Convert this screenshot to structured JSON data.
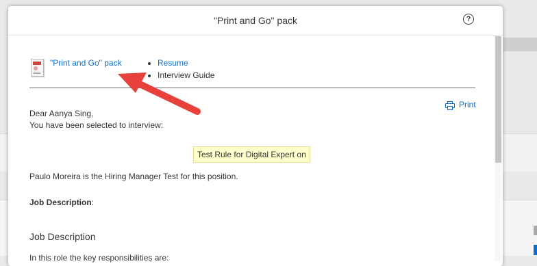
{
  "dialog": {
    "title": "\"Print and Go\" pack",
    "help_glyph": "?"
  },
  "pack": {
    "icon": "document-icon",
    "link_label": "\"Print and Go\" pack",
    "items": [
      {
        "label": "Resume",
        "is_link": true
      },
      {
        "label": "Interview Guide",
        "is_link": false
      }
    ]
  },
  "print_label": "Print",
  "letter": {
    "greeting": "Dear Aanya Sing,",
    "selected": "You have been selected to interview:",
    "rule_label": "Test Rule for Digital Expert on",
    "hiring_manager": "Paulo Moreira is the Hiring Manager Test for this position.",
    "job_desc_label": "Job Description",
    "job_desc_colon": ":",
    "job_desc_heading": "Job Description",
    "role_intro": "In this role the key responsibilities are:"
  },
  "colors": {
    "link": "#0a6ed1",
    "annotation_arrow": "#e8413c",
    "highlight_bg": "#ffffcc"
  }
}
